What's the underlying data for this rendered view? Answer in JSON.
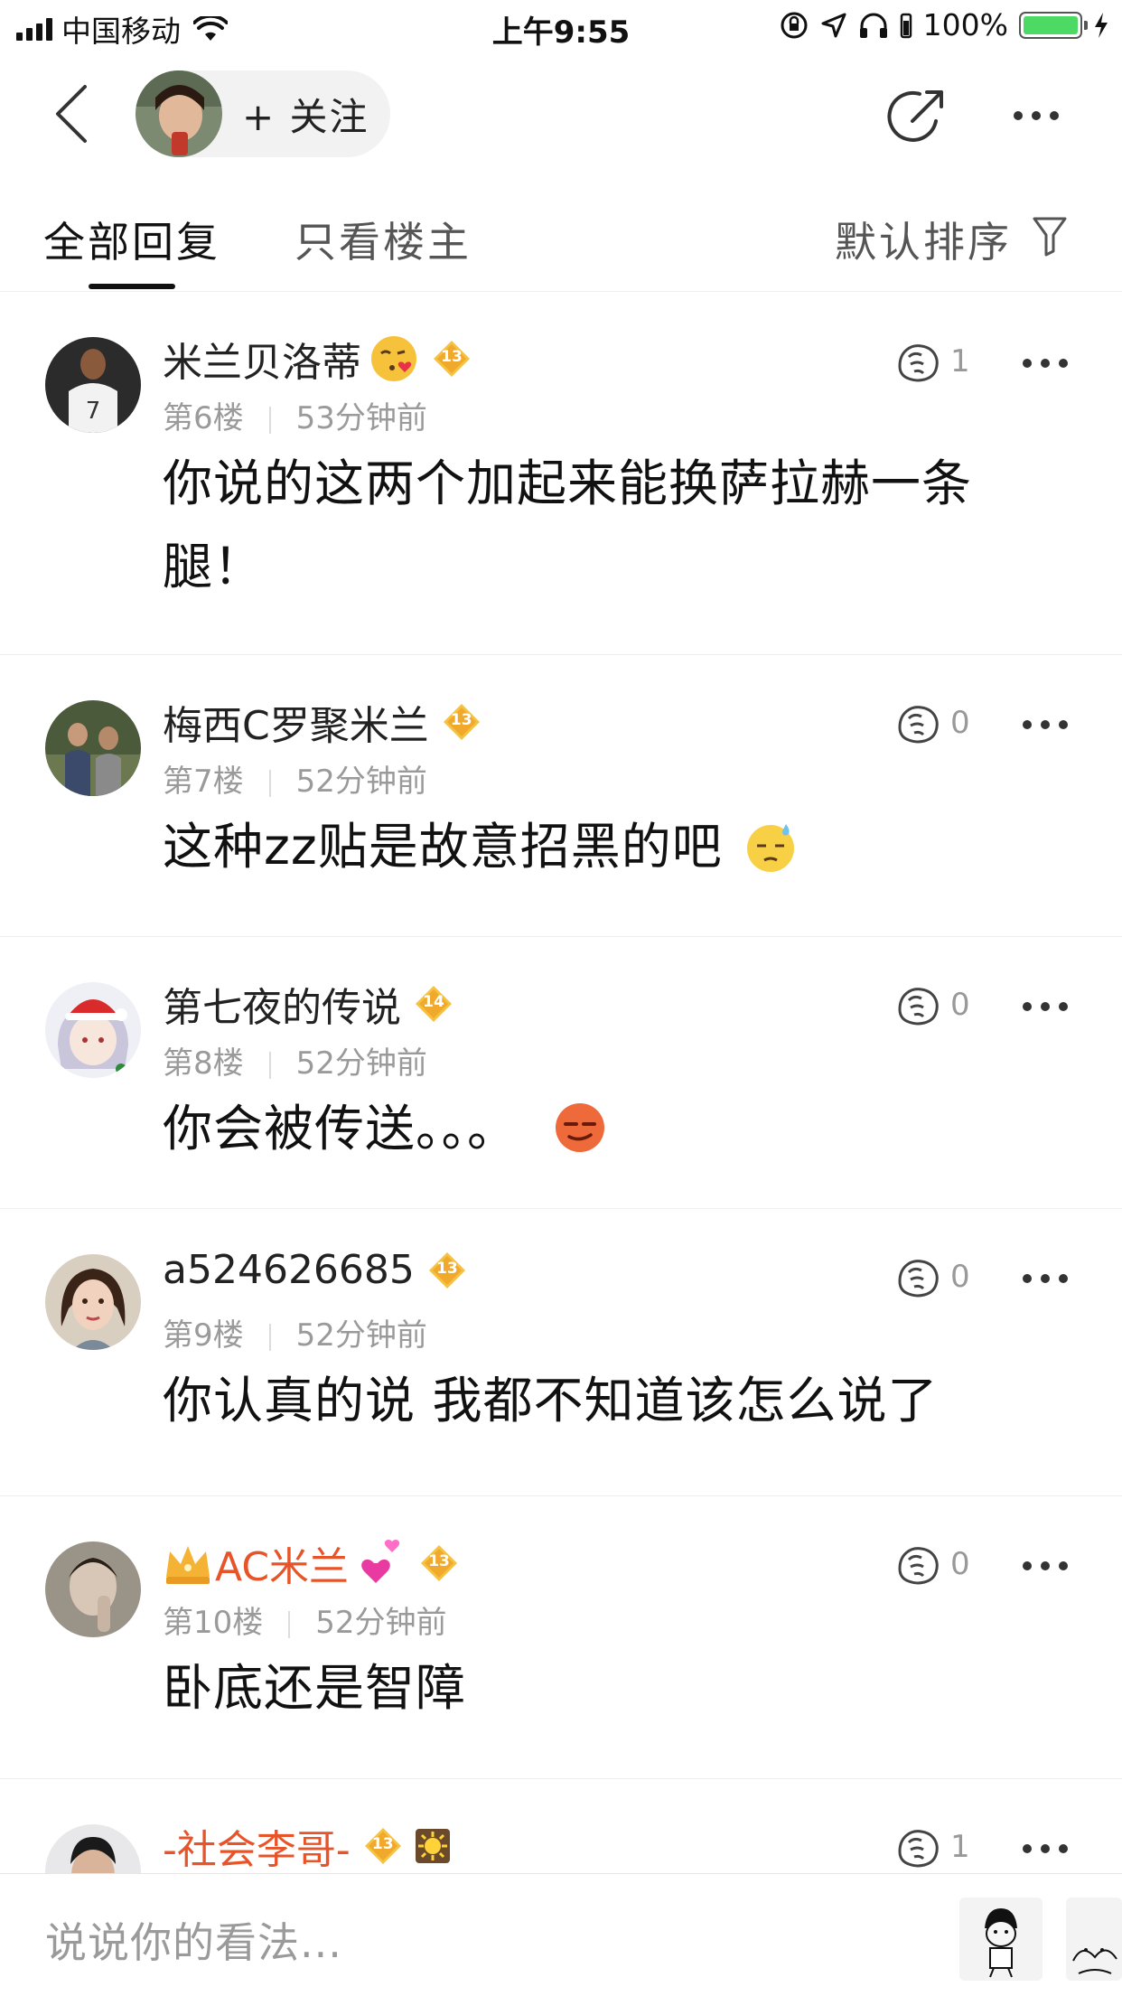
{
  "status_bar": {
    "carrier": "中国移动",
    "time": "上午9:55",
    "battery_pct": "100%",
    "battery_level": 1.0
  },
  "nav": {
    "follow_label": "+ 关注",
    "icons": [
      "chevron-left-icon",
      "share-icon",
      "more-icon"
    ]
  },
  "tabs": {
    "all_replies": "全部回复",
    "op_only": "只看楼主",
    "sort_label": "默认排序"
  },
  "comments": [
    {
      "username": "米兰贝洛蒂",
      "name_color": "#222222",
      "emoji": "kiss-emoji-icon",
      "level": "13",
      "floor": "第6楼",
      "time": "53分钟前",
      "likes": "1",
      "text": "你说的这两个加起来能换萨拉赫一条腿！"
    },
    {
      "username": "梅西C罗聚米兰",
      "name_color": "#222222",
      "level": "13",
      "floor": "第7楼",
      "time": "52分钟前",
      "likes": "0",
      "text": "这种zz贴是故意招黑的吧",
      "inline_emoji": "sweat-emoji-icon"
    },
    {
      "username": "第七夜的传说",
      "name_color": "#222222",
      "level": "14",
      "floor": "第8楼",
      "time": "52分钟前",
      "likes": "0",
      "text": "你会被传送。。。",
      "inline_emoji": "smirk-emoji-icon"
    },
    {
      "username": "a524626685",
      "name_color": "#222222",
      "level": "13",
      "floor": "第9楼",
      "time": "52分钟前",
      "likes": "0",
      "text": "你认真的说 我都不知道该怎么说了"
    },
    {
      "username": "AC米兰",
      "name_color": "#e8542a",
      "crown": "crown-icon",
      "emoji": "hearts-emoji-icon",
      "level": "13",
      "floor": "第10楼",
      "time": "52分钟前",
      "likes": "0",
      "text": "卧底还是智障"
    },
    {
      "username": "-社会李哥-",
      "name_color": "#e8542a",
      "level": "13",
      "badge": "sun-badge-icon",
      "likes": "1"
    }
  ],
  "input": {
    "placeholder": "说说你的看法..."
  },
  "colors": {
    "level_badge": "#f5c242",
    "name_vip": "#e8542a",
    "meta_text": "#9a9a9a"
  }
}
